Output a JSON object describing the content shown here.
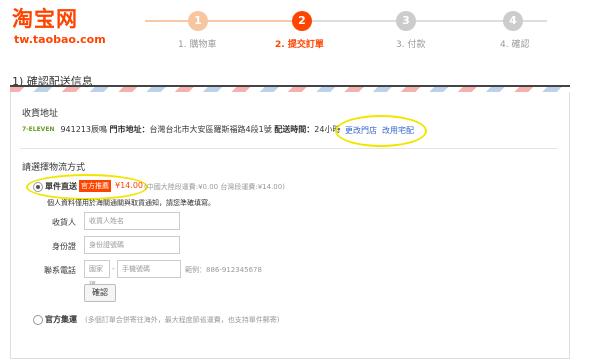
{
  "header": {
    "logo": "淘宝网",
    "logo_sub": "tw.taobao.com",
    "steps": [
      {
        "num": "1",
        "label": "1. 購物車"
      },
      {
        "num": "2",
        "label": "2. 提交訂單"
      },
      {
        "num": "3",
        "label": "3. 付款"
      },
      {
        "num": "4",
        "label": "4. 確認"
      }
    ]
  },
  "section_title": "1) 確認配送信息",
  "address": {
    "heading": "收貨地址",
    "store_logo": "7-ELEVEN",
    "postal": "941213",
    "store": "辰鳴",
    "addr_label": "門市地址：",
    "addr_value": "台灣台北市大安區羅斯福路4段1號",
    "time_label": "配送時間：",
    "time_value": "24小時",
    "link_change": "更改門店",
    "link_home": "改用宅配"
  },
  "shipping": {
    "heading": "請選擇物流方式",
    "option1": {
      "label": "單件直送",
      "badge": "官方推薦",
      "price": "¥14.00",
      "note": "(中國大陸段運費:¥0.00 台灣段運費:¥14.00)"
    },
    "info_note": "個人資料僅用於海關通關與取貨通知，請您準確填寫。",
    "form": {
      "recipient_label": "收貨人",
      "recipient_placeholder": "收貨人姓名",
      "id_label": "身份證",
      "id_placeholder": "身份證號碼",
      "phone_label": "聯系電話",
      "area_placeholder": "國家碼",
      "phone_placeholder": "手機號碼",
      "example": "範例：886-912345678",
      "confirm": "確認"
    },
    "option2": {
      "label": "官方集運",
      "note": "(多個訂單合併寄往海外，最大程度節省運費，也支持單件郵寄)"
    }
  },
  "colors": {
    "brand": "#ff4400",
    "link": "#3366cc",
    "highlight": "#f2e600"
  }
}
